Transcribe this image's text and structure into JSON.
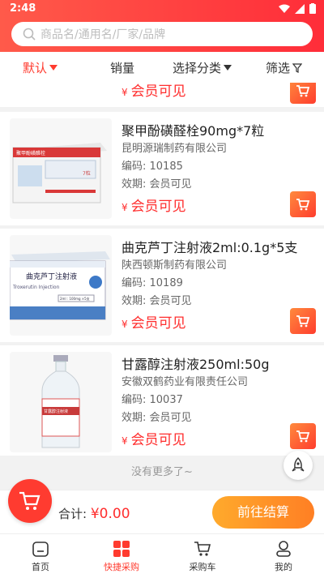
{
  "status": {
    "time": "2:48"
  },
  "search": {
    "placeholder": "商品名/通用名/厂家/品牌"
  },
  "filters": [
    {
      "label": "默认"
    },
    {
      "label": "销量"
    },
    {
      "label": "选择分类"
    },
    {
      "label": "筛选"
    }
  ],
  "partial_price": "会员可见",
  "currency": "¥",
  "products": [
    {
      "name": "聚甲酚磺醛栓90mg*7粒",
      "maker": "昆明源瑞制药有限公司",
      "code": "编码: 10185",
      "expiry": "效期: 会员可见",
      "price": "会员可见",
      "box_brand": "聚甲酚磺醛栓",
      "box_spec": "7粒"
    },
    {
      "name": "曲克芦丁注射液2ml:0.1g*5支",
      "maker": "陕西顿斯制药有限公司",
      "code": "编码: 10189",
      "expiry": "效期: 会员可见",
      "price": "会员可见",
      "box_brand": "曲克芦丁注射液",
      "box_sub": "Troxerutin Injection",
      "box_spec": "2ml : 100mg ×5支"
    },
    {
      "name": "甘露醇注射液250ml:50g",
      "maker": "安徽双鹤药业有限责任公司",
      "code": "编码: 10037",
      "expiry": "效期: 会员可见",
      "price": "会员可见",
      "box_brand": "甘露醇注射液"
    }
  ],
  "no_more": "没有更多了~",
  "cart": {
    "total_label": "合计:",
    "currency": "¥",
    "total_value": "0.00",
    "checkout_label": "前往结算"
  },
  "tabs": [
    {
      "label": "首页"
    },
    {
      "label": "快捷采购"
    },
    {
      "label": "采购车"
    },
    {
      "label": "我的"
    }
  ],
  "colors": {
    "brand": "#ff3b30",
    "accent_orange": "#ff8a2c",
    "price_red": "#ff2d2d"
  }
}
